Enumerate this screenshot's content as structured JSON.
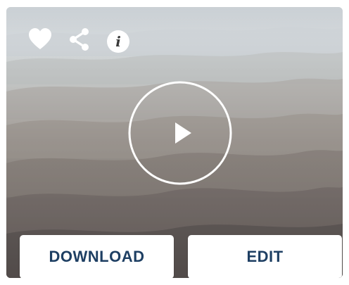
{
  "actions": {
    "favorite_icon": "heart-icon",
    "share_icon": "share-icon",
    "info_icon": "info-icon",
    "info_glyph": "i",
    "play_icon": "play-icon"
  },
  "buttons": {
    "download_label": "DOWNLOAD",
    "edit_label": "EDIT"
  },
  "colors": {
    "button_text": "#1e3f63",
    "button_bg": "#ffffff",
    "icon": "#ffffff"
  }
}
